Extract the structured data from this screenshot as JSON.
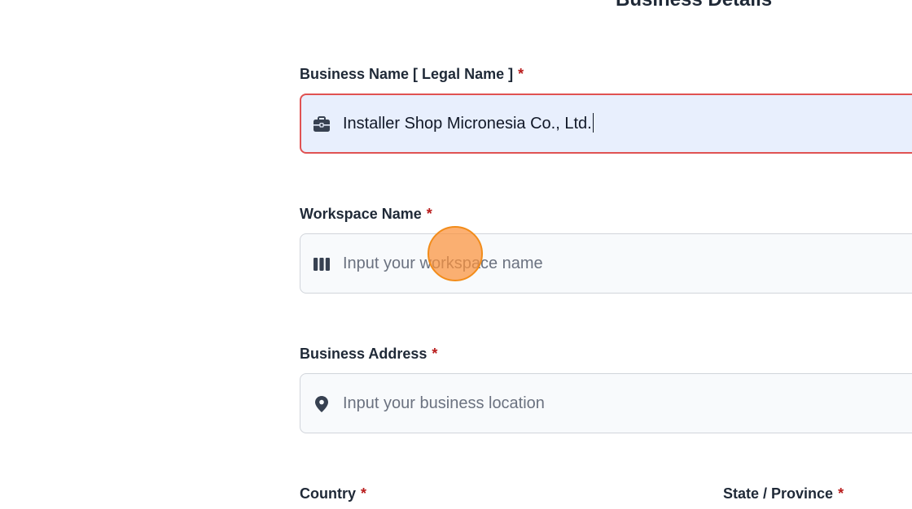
{
  "section": {
    "title": "Business Details"
  },
  "fields": {
    "business_name": {
      "label": "Business Name [ Legal Name ]",
      "required_mark": "*",
      "value": "Installer Shop Micronesia Co., Ltd.",
      "icon": "briefcase-icon"
    },
    "workspace_name": {
      "label": "Workspace Name",
      "required_mark": "*",
      "placeholder": "Input your workspace name",
      "icon": "columns-icon"
    },
    "business_address": {
      "label": "Business Address",
      "required_mark": "*",
      "placeholder": "Input your business location",
      "icon": "location-pin-icon"
    },
    "country": {
      "label": "Country",
      "required_mark": "*"
    },
    "state_province": {
      "label": "State / Province",
      "required_mark": "*"
    }
  },
  "colors": {
    "required": "#b91c1c",
    "focus_border": "#e05252",
    "focus_background": "#e8effd",
    "click_marker": "#f28c1a"
  }
}
